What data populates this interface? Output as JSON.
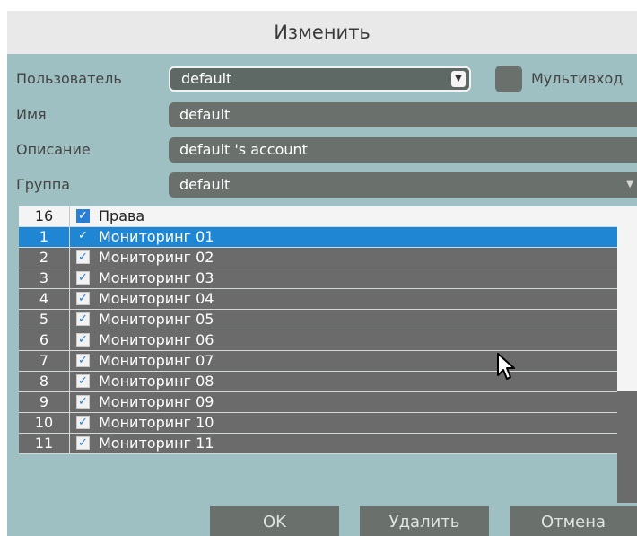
{
  "dialog": {
    "title": "Изменить"
  },
  "form": {
    "user_label": "Пользователь",
    "user_value": "default",
    "multi_label": "Мультивход",
    "name_label": "Имя",
    "name_value": "default",
    "desc_label": "Описание",
    "desc_value": "default 's account",
    "group_label": "Группа",
    "group_value": "default"
  },
  "permissions": {
    "header": {
      "count": "16",
      "label": "Права"
    },
    "rows": [
      {
        "num": "1",
        "label": "Мониторинг 01"
      },
      {
        "num": "2",
        "label": "Мониторинг 02"
      },
      {
        "num": "3",
        "label": "Мониторинг 03"
      },
      {
        "num": "4",
        "label": "Мониторинг 04"
      },
      {
        "num": "5",
        "label": "Мониторинг 05"
      },
      {
        "num": "6",
        "label": "Мониторинг 06"
      },
      {
        "num": "7",
        "label": "Мониторинг 07"
      },
      {
        "num": "8",
        "label": "Мониторинг 08"
      },
      {
        "num": "9",
        "label": "Мониторинг 09"
      },
      {
        "num": "10",
        "label": "Мониторинг 10"
      },
      {
        "num": "11",
        "label": "Мониторинг 11"
      }
    ],
    "selected_row": "1"
  },
  "buttons": {
    "ok": "OK",
    "delete": "Удалить",
    "cancel": "Отмена"
  },
  "colors": {
    "panel": "#9ec0c2",
    "field": "#6a716d",
    "row": "#6b6b6b",
    "selected": "#1f86d4",
    "title_bar": "#e9e9e9"
  },
  "icons": {
    "checkbox": "check-icon",
    "dropdown": "chevron-down-icon",
    "cursor": "mouse-pointer-icon"
  }
}
